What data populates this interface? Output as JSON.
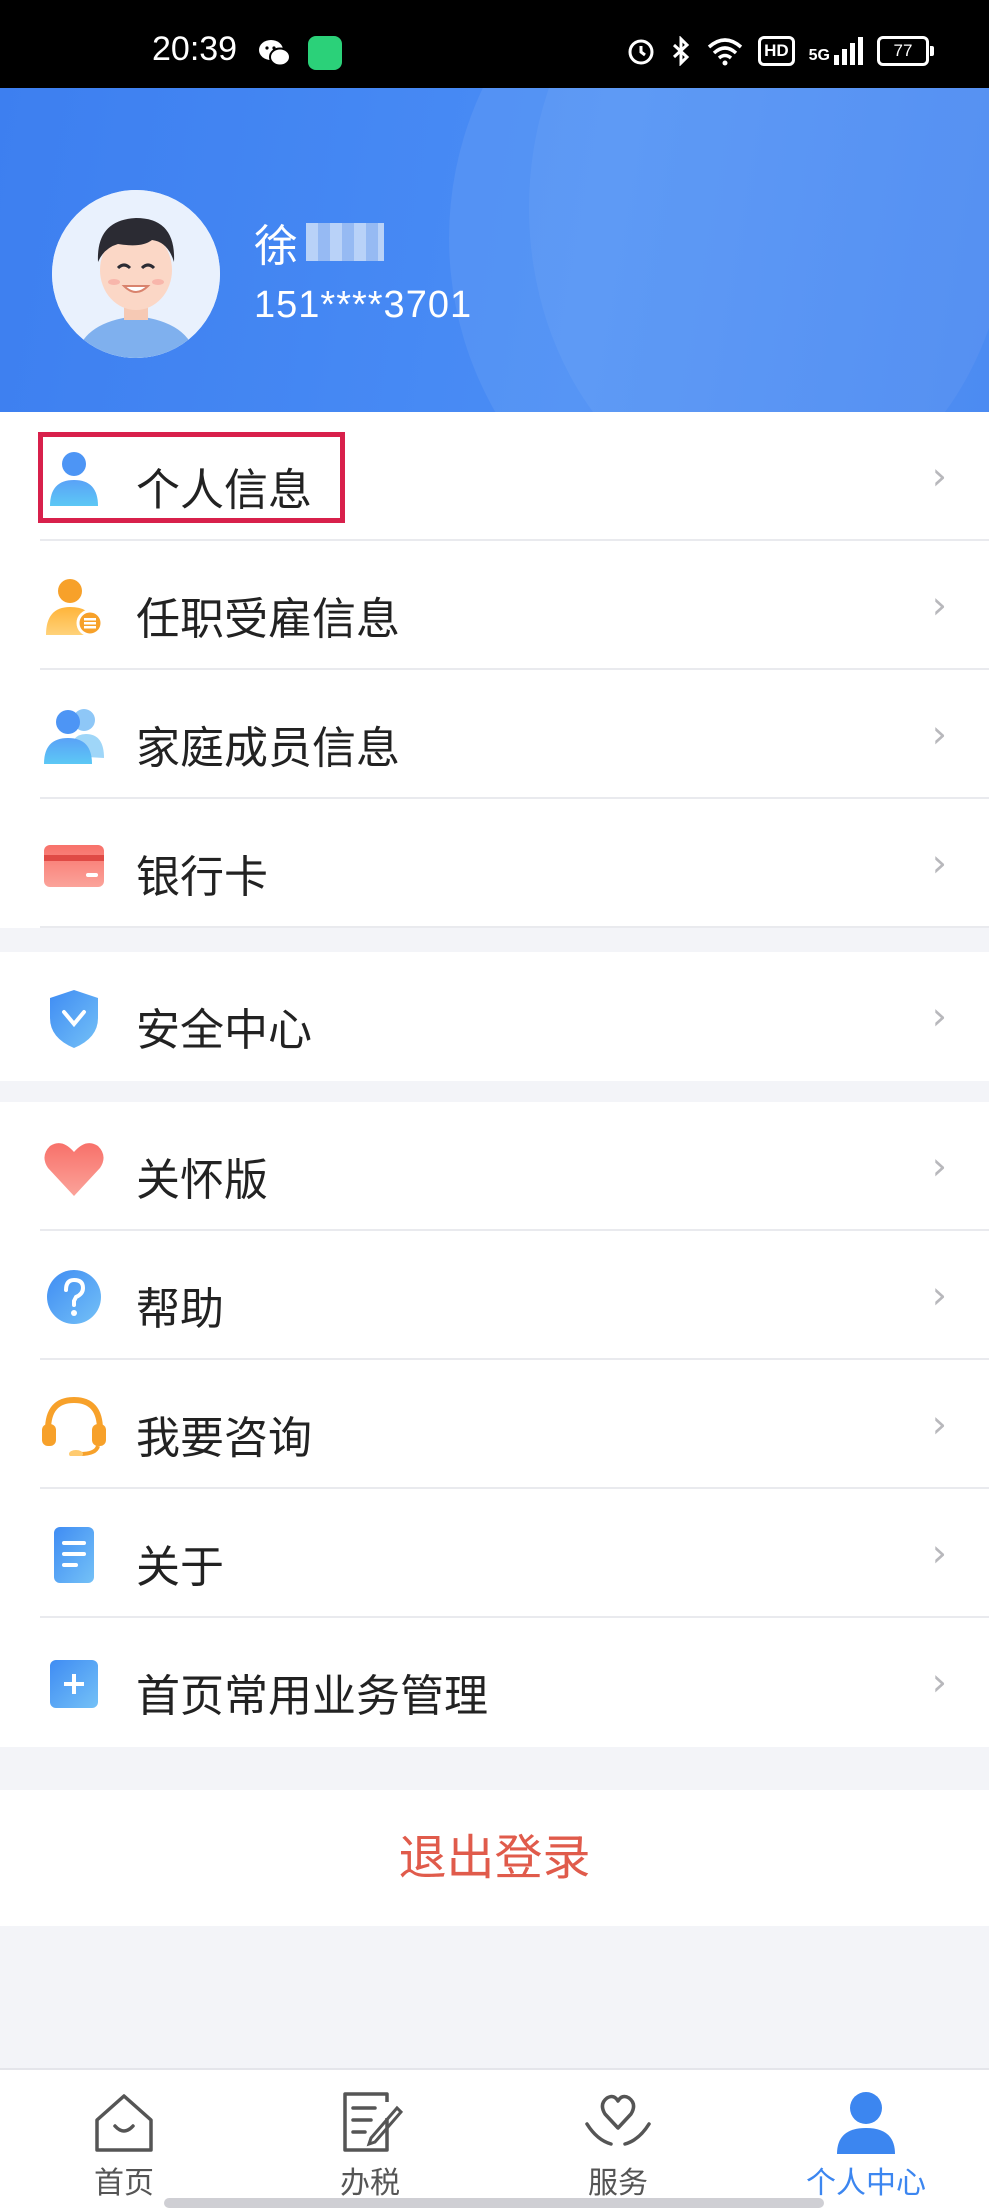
{
  "status_bar": {
    "time": "20:39",
    "hd": "HD",
    "network": "5G",
    "battery": "77"
  },
  "profile": {
    "name": "徐",
    "phone": "151****3701"
  },
  "menu_group_1": [
    {
      "label": "个人信息",
      "icon": "person-icon"
    },
    {
      "label": "任职受雇信息",
      "icon": "employment-icon"
    },
    {
      "label": "家庭成员信息",
      "icon": "family-icon"
    },
    {
      "label": "银行卡",
      "icon": "bank-card-icon"
    }
  ],
  "menu_group_2": [
    {
      "label": "安全中心",
      "icon": "shield-icon"
    }
  ],
  "menu_group_3": [
    {
      "label": "关怀版",
      "icon": "heart-icon"
    },
    {
      "label": "帮助",
      "icon": "help-icon"
    },
    {
      "label": "我要咨询",
      "icon": "headset-icon"
    },
    {
      "label": "关于",
      "icon": "document-icon"
    },
    {
      "label": "首页常用业务管理",
      "icon": "plus-icon"
    }
  ],
  "logout_label": "退出登录",
  "tabs": [
    {
      "label": "首页",
      "icon": "home-icon"
    },
    {
      "label": "办税",
      "icon": "tax-icon"
    },
    {
      "label": "服务",
      "icon": "service-icon"
    },
    {
      "label": "个人中心",
      "icon": "person-icon",
      "active": true
    }
  ],
  "colors": {
    "accent": "#3c86f0",
    "header": "#4a8df5",
    "logout": "#e05b4b",
    "highlight": "#d8204b"
  }
}
